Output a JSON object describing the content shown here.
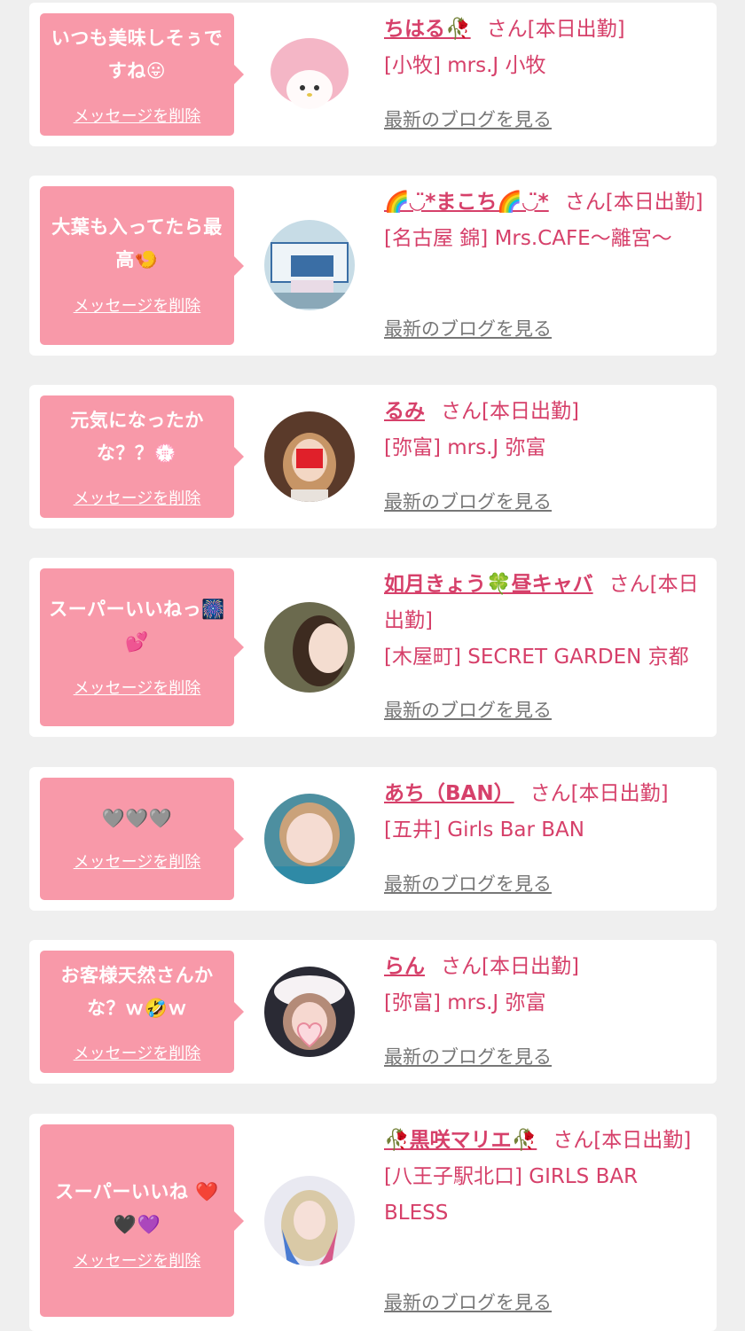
{
  "delete_label": "メッセージを削除",
  "blog_label": "最新のブログを見る",
  "san_suffix": "さん[本日出勤]",
  "colors": {
    "bubble": "#f899a9",
    "accent": "#d6406a",
    "blog_link": "#777777",
    "background": "#efefef"
  },
  "cards": [
    {
      "message": "いつも美味しそぅですね😛",
      "name": "ちはる🥀",
      "shop": "[小牧] mrs.J 小牧"
    },
    {
      "message": "大葉も入ってたら最高🍤",
      "name": "🌈◡̈*まこち🌈◡̈*",
      "shop": "[名古屋 錦] Mrs.CAFE〜離宮〜"
    },
    {
      "message": "元気になったかな？？💮",
      "name": "るみ",
      "shop": "[弥富] mrs.J 弥富"
    },
    {
      "message": "スーパーいいねっ🎆💕",
      "name": "如月きょう🍀昼キャバ",
      "shop": "[木屋町] SECRET GARDEN 京都"
    },
    {
      "message": "🩶🩶🩶",
      "name": "あち（BAN）",
      "shop": "[五井] Girls Bar BAN"
    },
    {
      "message": "お客様天然さんかな？ｗ🤣ｗ",
      "name": "らん",
      "shop": "[弥富] mrs.J 弥富"
    },
    {
      "message": "スーパーいいね ❤️🖤💜",
      "name": "🥀黒咲マリエ🥀",
      "shop": "[八王子駅北口] GIRLS BAR BLESS"
    }
  ]
}
